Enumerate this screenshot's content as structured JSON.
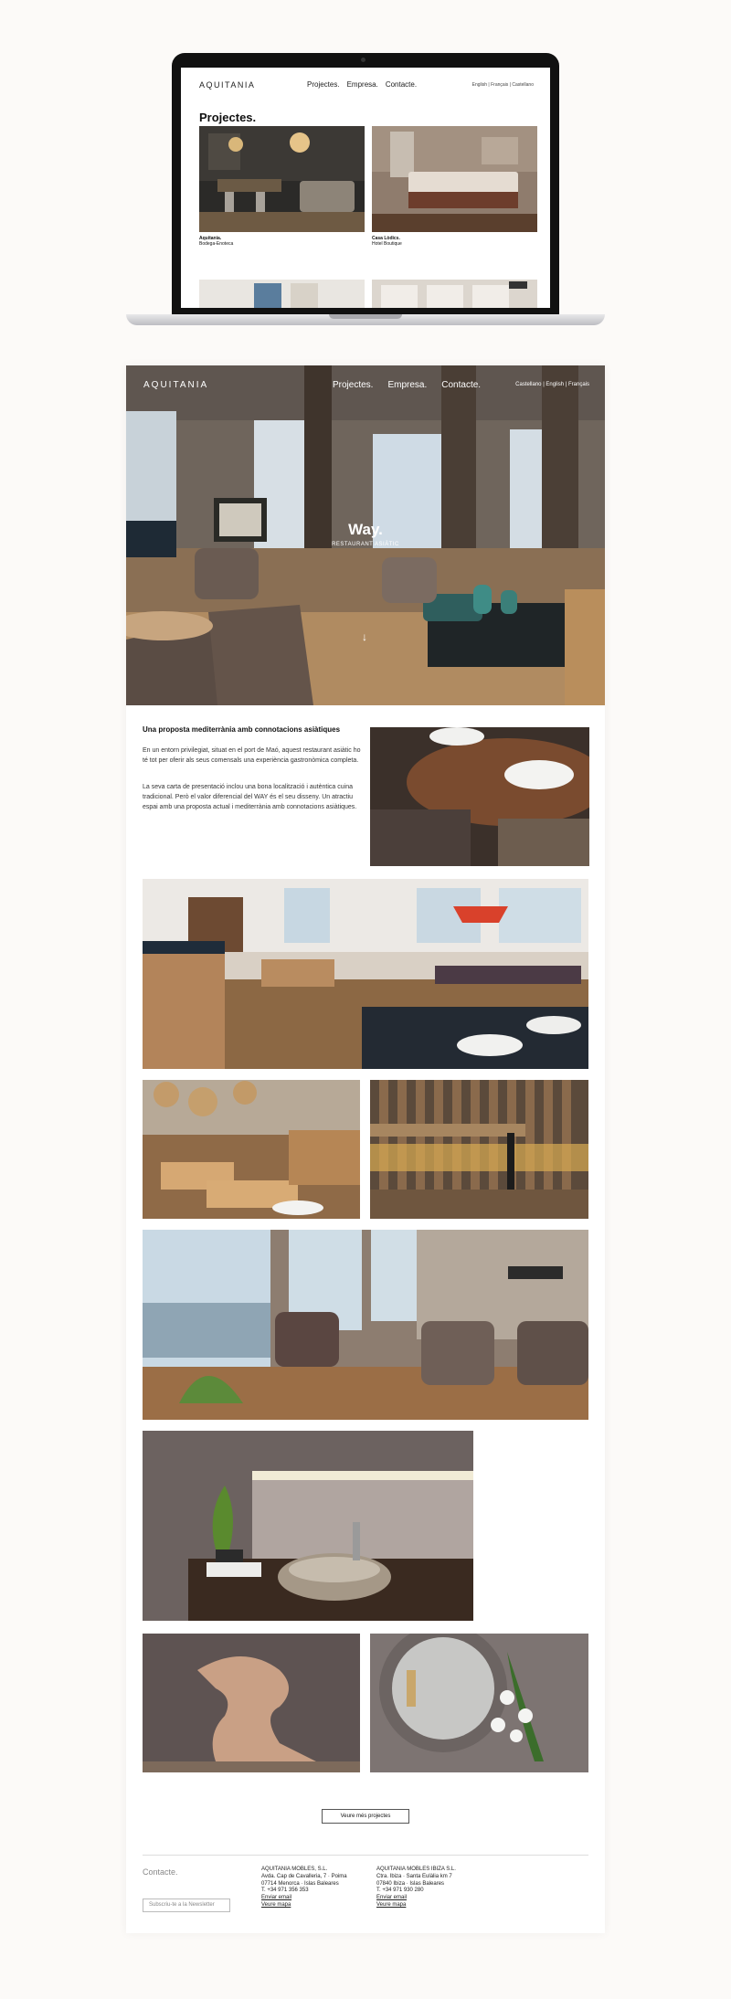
{
  "laptop_screen": {
    "logo": "AQUITANIA",
    "nav": [
      "Projectes.",
      "Empresa.",
      "Contacte."
    ],
    "languages": "English | Français | Castellano",
    "title": "Projectes.",
    "projects": [
      {
        "name": "Aquitania.",
        "type": "Bodega-Enoteca"
      },
      {
        "name": "Casa Lòdics.",
        "type": "Hotel Boutique"
      }
    ]
  },
  "hero": {
    "logo": "AQUITANIA",
    "nav": [
      "Projectes.",
      "Empresa.",
      "Contacte."
    ],
    "languages": "Castellano | English | Français",
    "title": "Way.",
    "subtitle": "RESTAURANT ASIÀTIC",
    "scroll_icon": "arrow-down-icon"
  },
  "intro": {
    "heading": "Una proposta mediterrània amb connotacions asiàtiques",
    "paragraphs": [
      "En un entorn privilegiat, situat en el port de Maó, aquest restaurant asiàtic ho té tot per oferir als seus comensals una experiència gastronòmica completa.",
      "La seva carta de presentació inclou una bona localització i autèntica cuina tradicional. Però el valor diferencial del WAY és el seu disseny. Un atractiu espai amb una proposta actual i mediterrània amb connotacions asiàtiques."
    ]
  },
  "more_projects_button": "Veure més projectes",
  "footer": {
    "contact_heading": "Contacte.",
    "newsletter_placeholder": "Subscriu-te a la Newsletter",
    "offices": [
      {
        "company": "AQUITANIA MOBLES, S.L.",
        "address1": "Avda. Cap de Cavalleria, 7 · Poima",
        "address2": "07714 Menorca · Islas Baleares",
        "phone": "T. +34 971 356 353",
        "email_link": "Enviar email",
        "map_link": "Veure mapa"
      },
      {
        "company": "AQUITANIA MOBLES IBIZA S.L.",
        "address1": "Ctra. Ibiza · Santa Eulàlia km 7",
        "address2": "07840 Ibiza · Islas Baleares",
        "phone": "T. +34 971 930 280",
        "email_link": "Enviar email",
        "map_link": "Veure mapa"
      }
    ]
  },
  "colors": {
    "background": "#fcfaf8",
    "text": "#222222",
    "muted": "#888888",
    "laptop_frame": "#111111"
  }
}
